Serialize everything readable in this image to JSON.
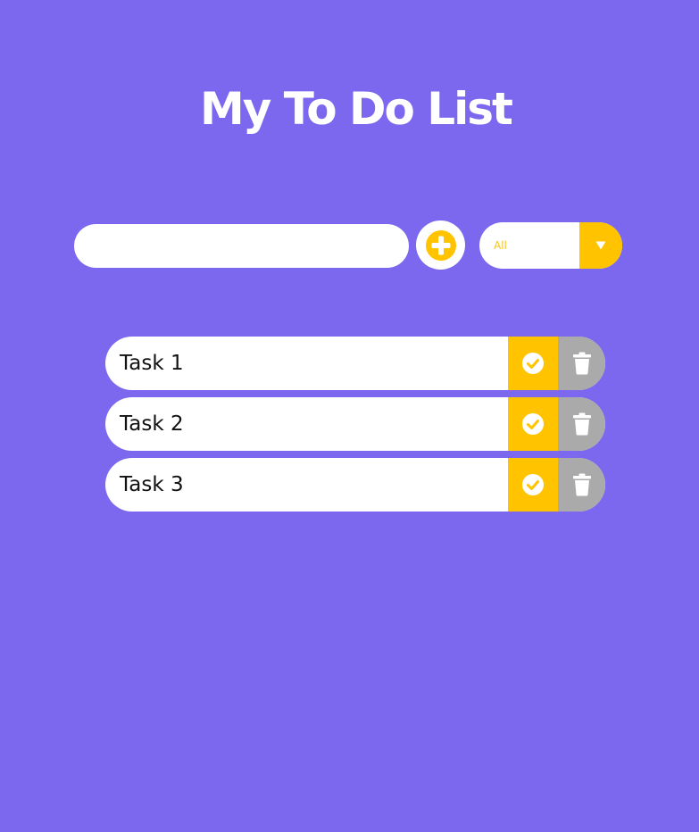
{
  "header": {
    "title": "My To Do List"
  },
  "form": {
    "input_value": "",
    "add_icon": "plus-circle-icon",
    "filter_selected": "All",
    "filter_arrow_icon": "caret-down-icon"
  },
  "todos": [
    {
      "text": "Task 1"
    },
    {
      "text": "Task 2"
    },
    {
      "text": "Task 3"
    }
  ],
  "colors": {
    "background": "#7b68ee",
    "accent": "#ffc300",
    "delete": "#aaaaaa",
    "surface": "#ffffff"
  }
}
